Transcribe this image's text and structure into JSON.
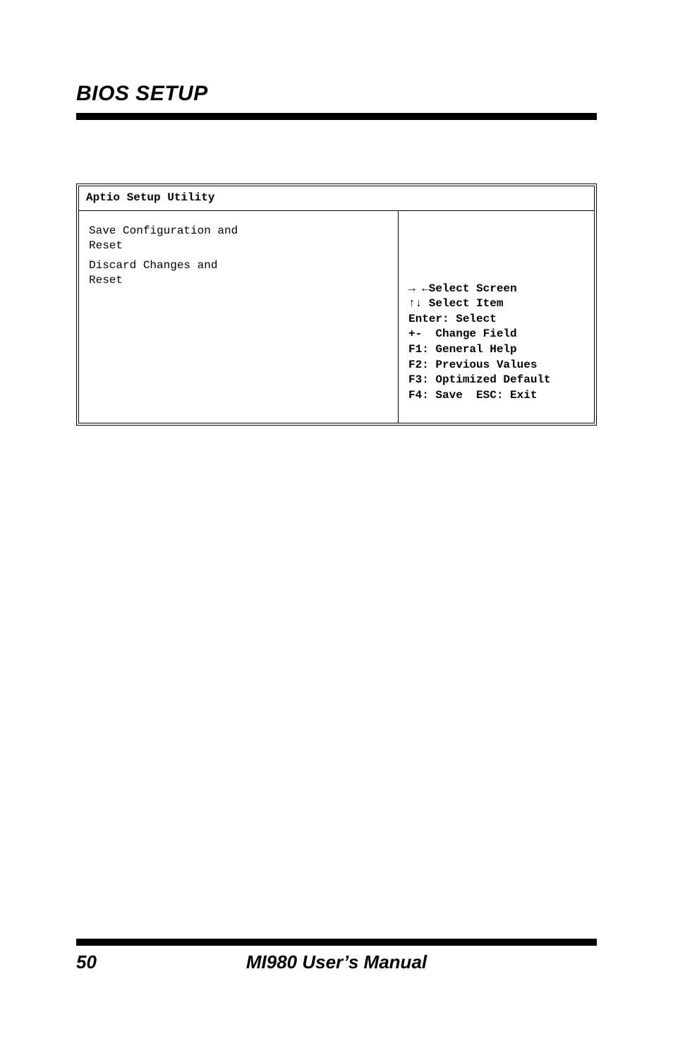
{
  "header": {
    "title": "BIOS SETUP"
  },
  "bios": {
    "title": "Aptio Setup Utility",
    "left": {
      "rows": [
        {
          "label": "Save Configuration and Reset",
          "value": ""
        },
        {
          "label": "Discard Changes and Reset",
          "value": ""
        }
      ]
    },
    "help": {
      "lines": [
        "→ ←Select Screen",
        "↑↓ Select Item",
        "Enter: Select",
        "+-  Change Field",
        "F1: General Help",
        "F2: Previous Values",
        "F3: Optimized Default",
        "F4: Save  ESC: Exit"
      ]
    }
  },
  "footer": {
    "page_number": "50",
    "manual_title": "MI980 User’s Manual"
  }
}
